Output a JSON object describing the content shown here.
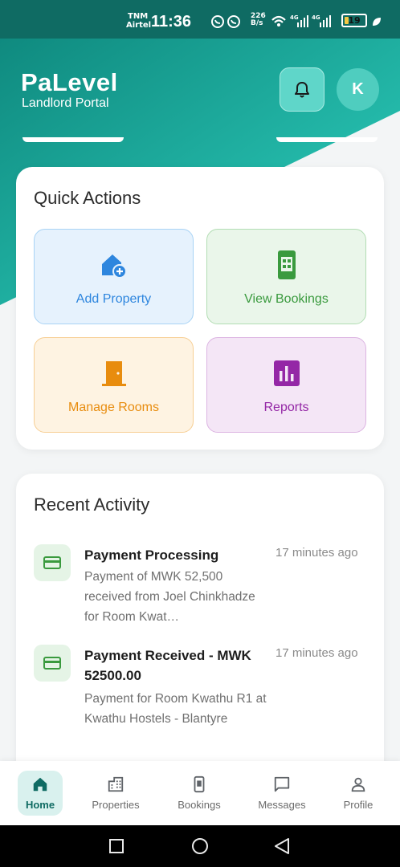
{
  "status_bar": {
    "carrier_line1": "TNM",
    "carrier_line2": "Airtel",
    "time": "11:36",
    "net_speed_value": "226",
    "net_speed_unit": "B/s",
    "battery_level": "19",
    "battery_color": "#f5c842"
  },
  "header": {
    "brand": "PaLevel",
    "subtitle": "Landlord Portal",
    "avatar_initial": "K",
    "bell_icon": "bell-icon",
    "gradient_start": "#0f8a7f",
    "gradient_end": "#2fd3c1"
  },
  "quick_actions": {
    "title": "Quick Actions",
    "items": [
      {
        "label": "Add Property",
        "icon": "home-add-icon",
        "color": "#2e86de"
      },
      {
        "label": "View Bookings",
        "icon": "booking-icon",
        "color": "#3a9a3e"
      },
      {
        "label": "Manage Rooms",
        "icon": "door-icon",
        "color": "#e88c0e"
      },
      {
        "label": "Reports",
        "icon": "bar-chart-icon",
        "color": "#9427a6"
      }
    ]
  },
  "recent_activity": {
    "title": "Recent Activity",
    "items": [
      {
        "title": "Payment Processing",
        "description": "Payment of MWK 52,500 received from Joel Chinkhadze for Room Kwat…",
        "time": "17 minutes ago",
        "icon": "credit-card-icon"
      },
      {
        "title": "Payment Received - MWK 52500.00",
        "description": "Payment for Room Kwathu R1 at Kwathu Hostels - Blantyre",
        "time": "17 minutes ago",
        "icon": "credit-card-icon"
      }
    ]
  },
  "bottom_nav": {
    "items": [
      {
        "label": "Home",
        "icon": "home-icon",
        "active": true
      },
      {
        "label": "Properties",
        "icon": "building-icon",
        "active": false
      },
      {
        "label": "Bookings",
        "icon": "booking-icon",
        "active": false
      },
      {
        "label": "Messages",
        "icon": "message-icon",
        "active": false
      },
      {
        "label": "Profile",
        "icon": "person-icon",
        "active": false
      }
    ]
  },
  "accent_color": "#0f6b63"
}
